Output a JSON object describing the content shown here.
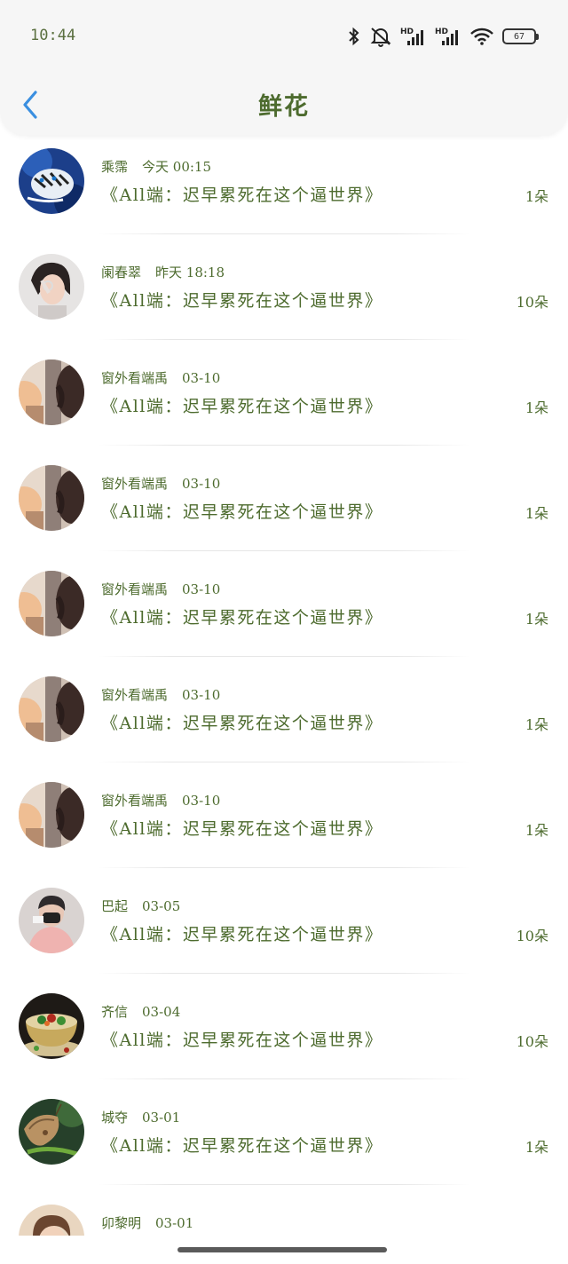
{
  "status_bar": {
    "time": "10:44",
    "battery": "67",
    "icons": [
      "bluetooth-icon",
      "mute-icon",
      "signal-hd-icon",
      "signal-hd-icon",
      "wifi-icon",
      "battery-icon"
    ]
  },
  "header": {
    "title": "鲜花",
    "back_icon": "chevron-left-icon"
  },
  "list": [
    {
      "name": "乘霈",
      "time": "今天 00:15",
      "title": "《All端：迟早累死在这个逼世界》",
      "count": "1朵",
      "avatar": "tiger"
    },
    {
      "name": "阑春翠",
      "time": "昨天 18:18",
      "title": "《All端：迟早累死在这个逼世界》",
      "count": "10朵",
      "avatar": "girl"
    },
    {
      "name": "窗外看端禹",
      "time": "03-10",
      "title": "《All端：迟早累死在这个逼世界》",
      "count": "1朵",
      "avatar": "window"
    },
    {
      "name": "窗外看端禹",
      "time": "03-10",
      "title": "《All端：迟早累死在这个逼世界》",
      "count": "1朵",
      "avatar": "window"
    },
    {
      "name": "窗外看端禹",
      "time": "03-10",
      "title": "《All端：迟早累死在这个逼世界》",
      "count": "1朵",
      "avatar": "window"
    },
    {
      "name": "窗外看端禹",
      "time": "03-10",
      "title": "《All端：迟早累死在这个逼世界》",
      "count": "1朵",
      "avatar": "window"
    },
    {
      "name": "窗外看端禹",
      "time": "03-10",
      "title": "《All端：迟早累死在这个逼世界》",
      "count": "1朵",
      "avatar": "window"
    },
    {
      "name": "巴起",
      "time": "03-05",
      "title": "《All端：迟早累死在这个逼世界》",
      "count": "10朵",
      "avatar": "pink"
    },
    {
      "name": "齐信",
      "time": "03-04",
      "title": "《All端：迟早累死在这个逼世界》",
      "count": "10朵",
      "avatar": "bowl"
    },
    {
      "name": "城夺",
      "time": "03-01",
      "title": "《All端：迟早累死在这个逼世界》",
      "count": "1朵",
      "avatar": "butterfly"
    },
    {
      "name": "卯黎明",
      "time": "03-01",
      "title": "",
      "count": "",
      "avatar": "boy"
    }
  ]
}
